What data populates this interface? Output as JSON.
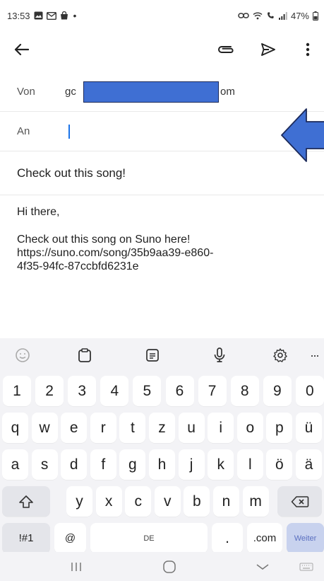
{
  "status": {
    "time": "13:53",
    "battery": "47%"
  },
  "compose": {
    "from_label": "Von",
    "from_value_start": "gc",
    "from_value_end": "om",
    "to_label": "An",
    "to_value": "",
    "subject": "Check out this song!",
    "body_greeting": "Hi there,",
    "body_lines": [
      "Check out this song on Suno here!",
      "https://suno.com/song/35b9aa39-e860-",
      "4f35-94fc-87ccbfd6231e"
    ]
  },
  "keyboard": {
    "number_row": [
      "1",
      "2",
      "3",
      "4",
      "5",
      "6",
      "7",
      "8",
      "9",
      "0"
    ],
    "row1": [
      "q",
      "w",
      "e",
      "r",
      "t",
      "z",
      "u",
      "i",
      "o",
      "p",
      "ü"
    ],
    "row2": [
      "a",
      "s",
      "d",
      "f",
      "g",
      "h",
      "j",
      "k",
      "l",
      "ö",
      "ä"
    ],
    "row3": [
      "y",
      "x",
      "c",
      "v",
      "b",
      "n",
      "m"
    ],
    "symbols_label": "!#1",
    "at_label": "@",
    "space_label": "DE",
    "dot_label": ".",
    "dotcom_label": ".com",
    "enter_label": "Weiter",
    "more_label": "···"
  },
  "colors": {
    "redaction": "#3f6fd3",
    "arrow": "#3f6fd3",
    "keyboard_bg": "#f3f3f6"
  }
}
